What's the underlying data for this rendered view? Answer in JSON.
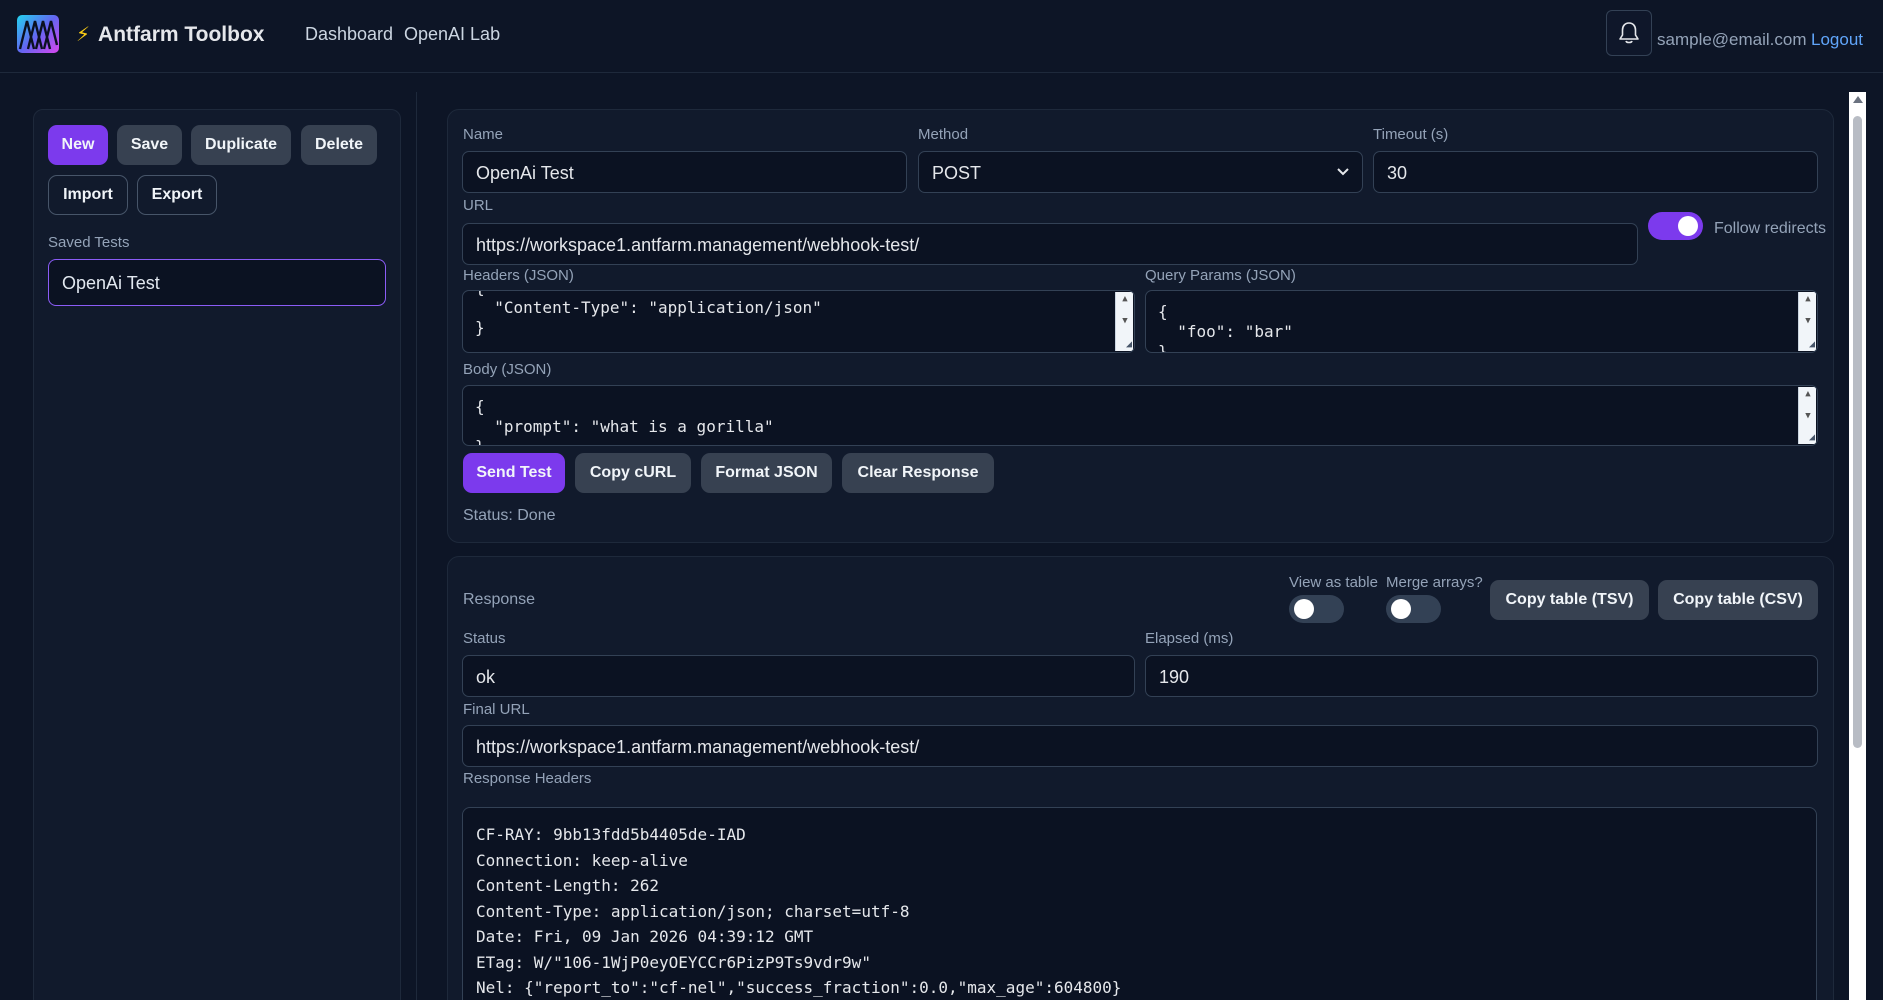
{
  "header": {
    "brand_bolt": "⚡",
    "brand": "Antfarm Toolbox",
    "nav": [
      {
        "label": "Dashboard"
      },
      {
        "label": "OpenAI Lab"
      }
    ],
    "user_email": "sample@email.com",
    "logout_label": "Logout"
  },
  "sidebar": {
    "buttons": {
      "new": "New",
      "save": "Save",
      "duplicate": "Duplicate",
      "delete": "Delete",
      "import": "Import",
      "export": "Export"
    },
    "saved_tests_label": "Saved Tests",
    "saved_tests": [
      {
        "name": "OpenAi Test"
      }
    ]
  },
  "request": {
    "name_label": "Name",
    "name_value": "OpenAi Test",
    "method_label": "Method",
    "method_value": "POST",
    "timeout_label": "Timeout (s)",
    "timeout_value": "30",
    "url_label": "URL",
    "url_value": "https://workspace1.antfarm.management/webhook-test/",
    "follow_redirects_label": "Follow redirects",
    "follow_redirects": true,
    "headers_label": "Headers (JSON)",
    "headers_value": "{\n  \"Content-Type\": \"application/json\"\n}",
    "query_label": "Query Params (JSON)",
    "query_value": "{\n  \"foo\": \"bar\"\n}",
    "body_label": "Body (JSON)",
    "body_value": "{\n  \"prompt\": \"what is a gorilla\"\n}",
    "actions": {
      "send": "Send Test",
      "copy_curl": "Copy cURL",
      "format_json": "Format JSON",
      "clear_response": "Clear Response"
    },
    "status_text": "Status: Done"
  },
  "response": {
    "title": "Response",
    "view_as_table_label": "View as table",
    "view_as_table": false,
    "merge_arrays_label": "Merge arrays?",
    "merge_arrays": false,
    "copy_tsv": "Copy table (TSV)",
    "copy_csv": "Copy table (CSV)",
    "status_label": "Status",
    "status_value": "ok",
    "elapsed_label": "Elapsed (ms)",
    "elapsed_value": "190",
    "final_url_label": "Final URL",
    "final_url_value": "https://workspace1.antfarm.management/webhook-test/",
    "headers_label": "Response Headers",
    "headers_value": "CF-RAY: 9bb13fdd5b4405de-IAD\nConnection: keep-alive\nContent-Length: 262\nContent-Type: application/json; charset=utf-8\nDate: Fri, 09 Jan 2026 04:39:12 GMT\nETag: W/\"106-1WjP0eyOEYCCr6PizP9Ts9vdr9w\"\nNel: {\"report_to\":\"cf-nel\",\"success_fraction\":0.0,\"max_age\":604800}"
  },
  "colors": {
    "background": "#0d1526",
    "panel": "#111a2c",
    "accent": "#7c3aed",
    "link": "#60a5fa"
  }
}
